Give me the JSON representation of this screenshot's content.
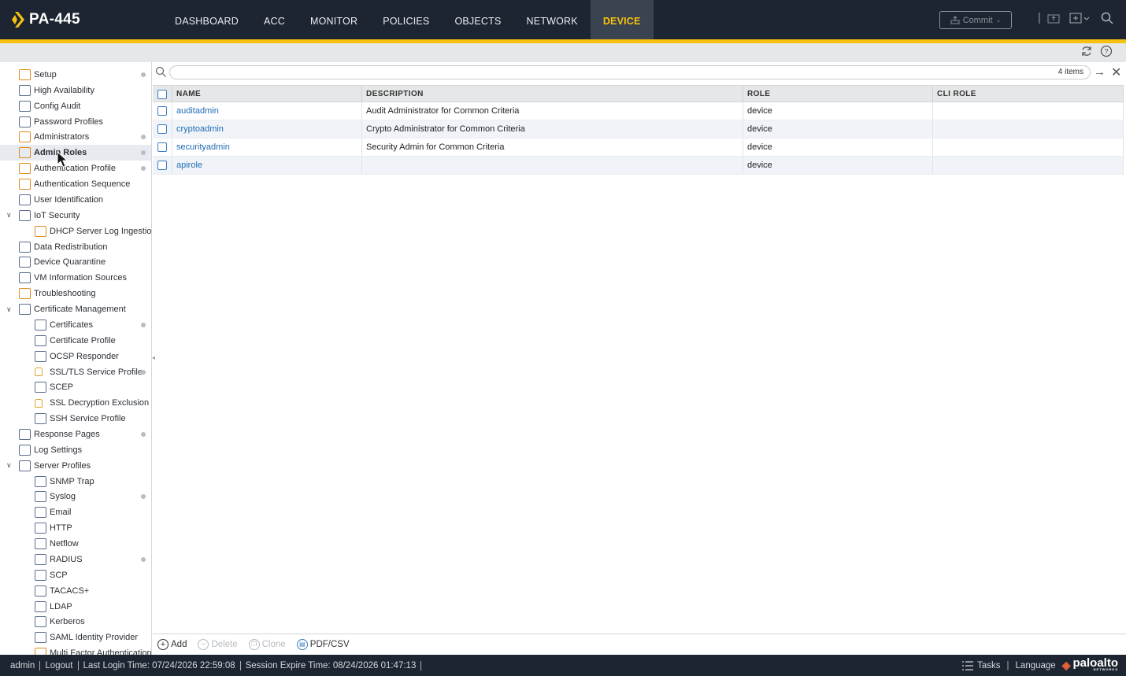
{
  "app": {
    "name": "PA-445"
  },
  "nav": {
    "tabs": [
      "DASHBOARD",
      "ACC",
      "MONITOR",
      "POLICIES",
      "OBJECTS",
      "NETWORK",
      "DEVICE"
    ],
    "active": "DEVICE"
  },
  "commit_label": "Commit",
  "sidebar": {
    "items": [
      {
        "label": "Setup",
        "level": 0,
        "icon": "setup-icon",
        "dot": true
      },
      {
        "label": "High Availability",
        "level": 0,
        "icon": "high-availability-icon"
      },
      {
        "label": "Config Audit",
        "level": 0,
        "icon": "config-audit-icon"
      },
      {
        "label": "Password Profiles",
        "level": 0,
        "icon": "password-profiles-icon"
      },
      {
        "label": "Administrators",
        "level": 0,
        "icon": "administrator-icon",
        "dot": true
      },
      {
        "label": "Admin Roles",
        "level": 0,
        "icon": "admin-roles-icon",
        "dot": true,
        "selected": true
      },
      {
        "label": "Authentication Profile",
        "level": 0,
        "icon": "authentication-profile-icon",
        "dot": true
      },
      {
        "label": "Authentication Sequence",
        "level": 0,
        "icon": "authentication-sequence-icon"
      },
      {
        "label": "User Identification",
        "level": 0,
        "icon": "user-identification-icon"
      },
      {
        "label": "IoT Security",
        "level": 0,
        "icon": "iot-security-icon",
        "expanded": true
      },
      {
        "label": "DHCP Server Log Ingestion",
        "level": 1,
        "icon": "dhcp-server-icon"
      },
      {
        "label": "Data Redistribution",
        "level": 0,
        "icon": "data-redistribution-icon"
      },
      {
        "label": "Device Quarantine",
        "level": 0,
        "icon": "device-quarantine-icon"
      },
      {
        "label": "VM Information Sources",
        "level": 0,
        "icon": "vm-information-icon"
      },
      {
        "label": "Troubleshooting",
        "level": 0,
        "icon": "troubleshooting-icon"
      },
      {
        "label": "Certificate Management",
        "level": 0,
        "icon": "certificate-management-icon",
        "expanded": true
      },
      {
        "label": "Certificates",
        "level": 1,
        "icon": "certificate-icon",
        "dot": true
      },
      {
        "label": "Certificate Profile",
        "level": 1,
        "icon": "certificate-profile-icon"
      },
      {
        "label": "OCSP Responder",
        "level": 1,
        "icon": "ocsp-responder-icon"
      },
      {
        "label": "SSL/TLS Service Profile",
        "level": 1,
        "icon": "lock-icon",
        "dot": true
      },
      {
        "label": "SCEP",
        "level": 1,
        "icon": "scep-icon"
      },
      {
        "label": "SSL Decryption Exclusion",
        "level": 1,
        "icon": "lock-icon"
      },
      {
        "label": "SSH Service Profile",
        "level": 1,
        "icon": "ssh-service-profile-icon"
      },
      {
        "label": "Response Pages",
        "level": 0,
        "icon": "response-pages-icon",
        "dot": true
      },
      {
        "label": "Log Settings",
        "level": 0,
        "icon": "log-settings-icon"
      },
      {
        "label": "Server Profiles",
        "level": 0,
        "icon": "server-profiles-icon",
        "expanded": true
      },
      {
        "label": "SNMP Trap",
        "level": 1,
        "icon": "snmp-trap-icon"
      },
      {
        "label": "Syslog",
        "level": 1,
        "icon": "syslog-icon",
        "dot": true
      },
      {
        "label": "Email",
        "level": 1,
        "icon": "email-icon"
      },
      {
        "label": "HTTP",
        "level": 1,
        "icon": "http-icon"
      },
      {
        "label": "Netflow",
        "level": 1,
        "icon": "netflow-icon"
      },
      {
        "label": "RADIUS",
        "level": 1,
        "icon": "radius-icon",
        "dot": true
      },
      {
        "label": "SCP",
        "level": 1,
        "icon": "scp-icon"
      },
      {
        "label": "TACACS+",
        "level": 1,
        "icon": "tacacs-icon"
      },
      {
        "label": "LDAP",
        "level": 1,
        "icon": "ldap-icon"
      },
      {
        "label": "Kerberos",
        "level": 1,
        "icon": "kerberos-icon"
      },
      {
        "label": "SAML Identity Provider",
        "level": 1,
        "icon": "saml-identity-provider-icon"
      },
      {
        "label": "Multi Factor Authentication",
        "level": 1,
        "icon": "multi-factor-authentication-icon"
      }
    ]
  },
  "filter": {
    "count_text": "4 items",
    "value": ""
  },
  "table": {
    "columns": [
      "NAME",
      "DESCRIPTION",
      "ROLE",
      "CLI ROLE"
    ],
    "rows": [
      {
        "name": "auditadmin",
        "description": "Audit Administrator for Common Criteria",
        "role": "device",
        "cli_role": ""
      },
      {
        "name": "cryptoadmin",
        "description": "Crypto Administrator for Common Criteria",
        "role": "device",
        "cli_role": ""
      },
      {
        "name": "securityadmin",
        "description": "Security Admin for Common Criteria",
        "role": "device",
        "cli_role": ""
      },
      {
        "name": "apirole",
        "description": "",
        "role": "device",
        "cli_role": ""
      }
    ]
  },
  "toolbar": {
    "add": "Add",
    "delete": "Delete",
    "clone": "Clone",
    "pdf_csv": "PDF/CSV"
  },
  "status": {
    "user": "admin",
    "logout": "Logout",
    "last_login": "Last Login Time: 07/24/2026 22:59:08",
    "session_expire": "Session Expire Time: 08/24/2026 01:47:13",
    "tasks": "Tasks",
    "language": "Language",
    "brand": "paloalto",
    "brand_sub": "NETWORKS"
  },
  "colors": {
    "accent": "#f7c20f",
    "header_bg": "#1c2531",
    "link": "#1f6bb5",
    "brand_mark": "#f0643c"
  }
}
